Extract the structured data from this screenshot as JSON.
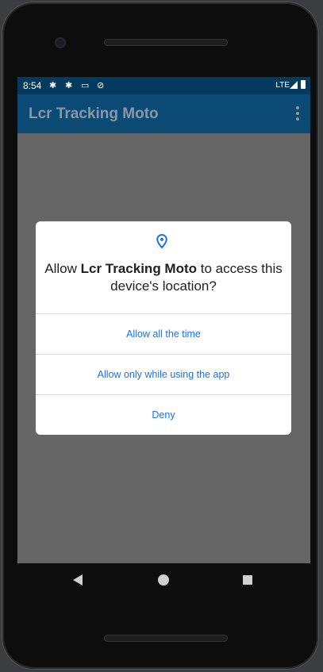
{
  "status_bar": {
    "time": "8:54",
    "icons": [
      "gear-icon",
      "gear-icon",
      "keyboard-icon",
      "no-disturb-icon"
    ],
    "network": "LTE",
    "signal_icon": "signal-icon",
    "battery_icon": "battery-icon"
  },
  "app_bar": {
    "title": "Lcr Tracking Moto",
    "menu_icon": "overflow-menu-icon"
  },
  "dialog": {
    "icon": "location-pin-icon",
    "title_prefix": "Allow ",
    "app_name": "Lcr Tracking Moto",
    "title_suffix": " to access this device's location?",
    "options": [
      "Allow all the time",
      "Allow only while using the app",
      "Deny"
    ]
  },
  "nav_bar": {
    "back_icon": "back-icon",
    "home_icon": "home-icon",
    "recents_icon": "recents-icon"
  },
  "colors": {
    "status_bar": "#053a5f",
    "app_bar": "#0a4a75",
    "accent": "#1a73e8"
  }
}
